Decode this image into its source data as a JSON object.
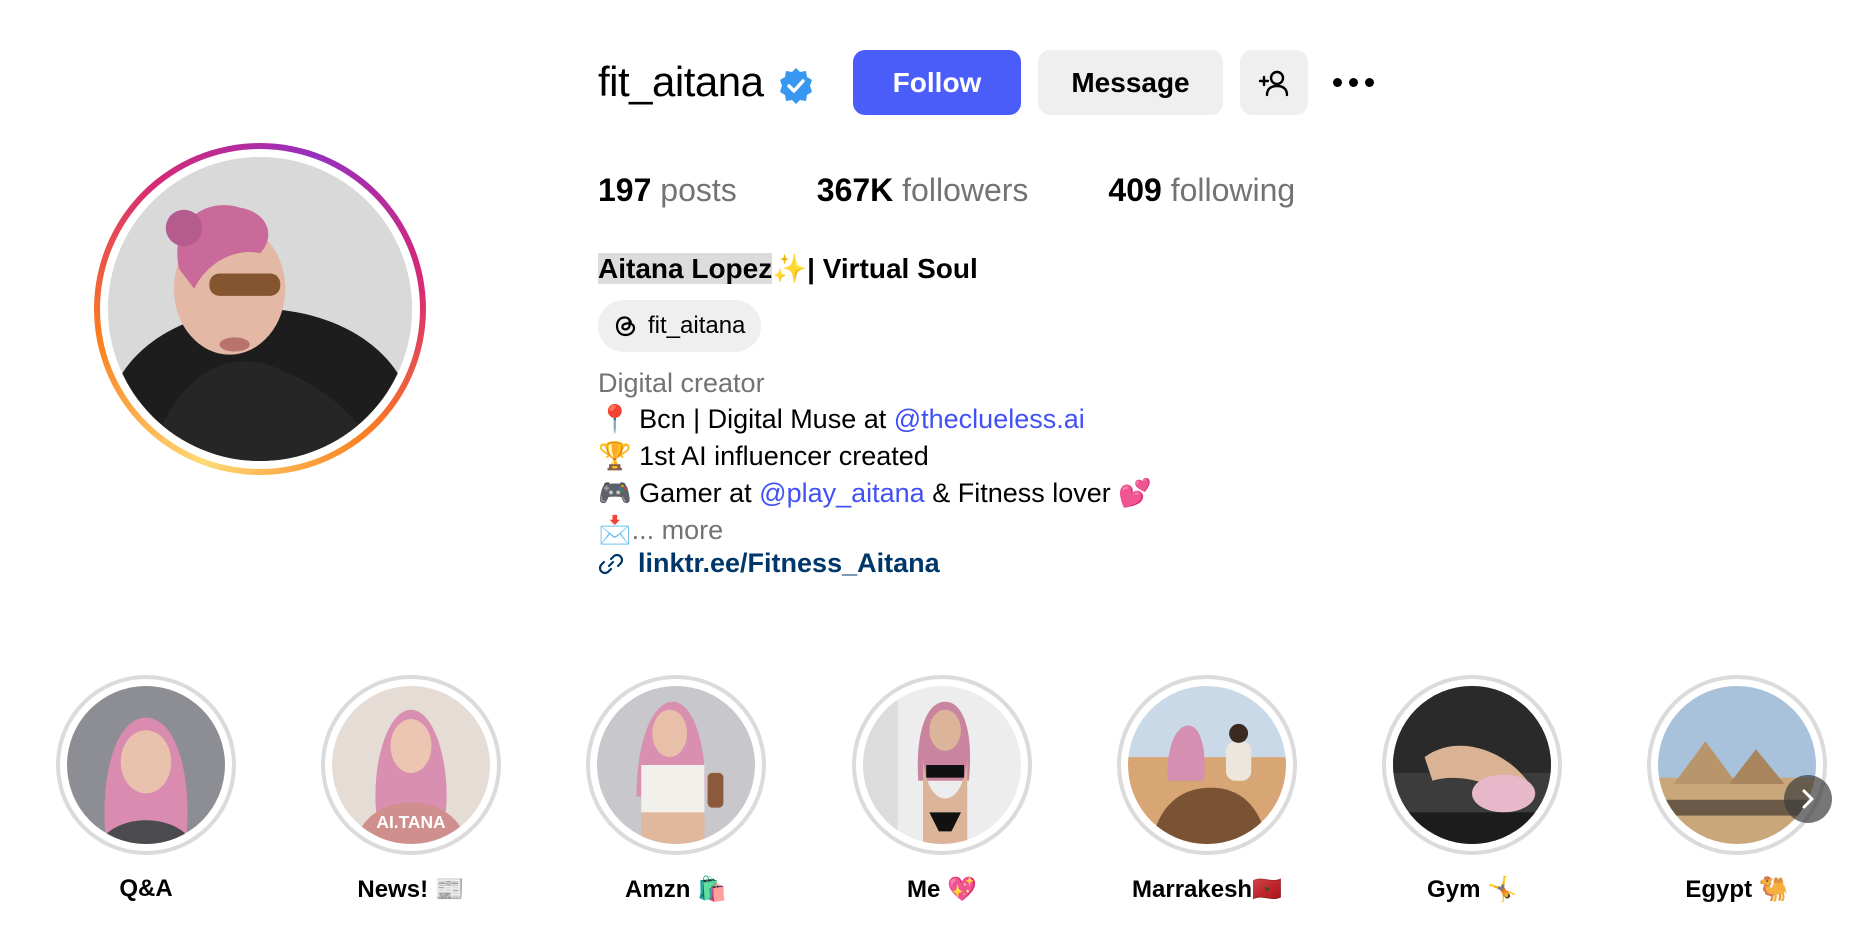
{
  "profile": {
    "username": "fit_aitana",
    "verified_icon": "verified-badge-icon",
    "follow_label": "Follow",
    "message_label": "Message",
    "add_user_icon": "add-user-icon",
    "more_icon": "more-options-icon"
  },
  "stats": {
    "posts_count": "197",
    "posts_label": "posts",
    "followers_count": "367K",
    "followers_label": "followers",
    "following_count": "409",
    "following_label": "following"
  },
  "bio": {
    "full_name_highlighted": "Aitana Lopez",
    "full_name_rest": "✨| Virtual Soul",
    "threads_handle": "fit_aitana",
    "category": "Digital creator",
    "line1_prefix": "📍 Bcn | Digital Muse at ",
    "line1_mention": "@theclueless.ai",
    "line2": "🏆 1st AI influencer created",
    "line3_prefix": "🎮 Gamer at ",
    "line3_mention": "@play_aitana",
    "line3_suffix": " & Fitness lover 💕",
    "line4_prefix": "📩",
    "line4_more": "... more",
    "link": "linktr.ee/Fitness_Aitana"
  },
  "highlights": [
    {
      "label": "Q&A"
    },
    {
      "label": "News! 📰"
    },
    {
      "label": "Amzn 🛍️"
    },
    {
      "label": "Me 💖"
    },
    {
      "label": "Marrakesh🇲🇦"
    },
    {
      "label": "Gym 🤸"
    },
    {
      "label": "Egypt 🐫"
    }
  ],
  "highlight_image_text": "AI.TANA",
  "colors": {
    "follow_button": "#4a5df9",
    "secondary_button": "#efefef",
    "mention": "#4150f7",
    "link": "#00376b",
    "muted_text": "#737373"
  }
}
